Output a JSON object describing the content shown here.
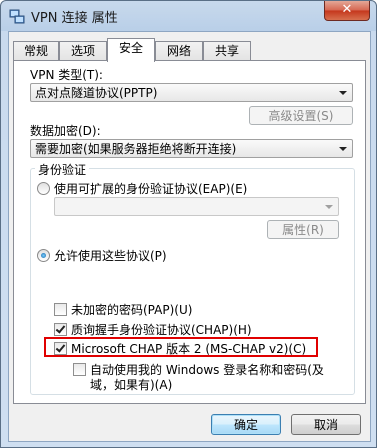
{
  "window": {
    "title": "VPN 连接 属性",
    "close_glyph": "✕"
  },
  "tabs": [
    {
      "label": "常规",
      "active": false
    },
    {
      "label": "选项",
      "active": false
    },
    {
      "label": "安全",
      "active": true
    },
    {
      "label": "网络",
      "active": false
    },
    {
      "label": "共享",
      "active": false
    }
  ],
  "vpn_type": {
    "label": "VPN 类型(T):",
    "value": "点对点隧道协议(PPTP)"
  },
  "advanced_button": "高级设置(S)",
  "encryption": {
    "label": "数据加密(D):",
    "value": "需要加密(如果服务器拒绝将断开连接)"
  },
  "auth_group": {
    "title": "身份验证",
    "eap_radio_label": "使用可扩展的身份验证协议(EAP)(E)",
    "eap_combo_value": "",
    "properties_button": "属性(R)",
    "allow_radio_label": "允许使用这些协议(P)"
  },
  "protocols": [
    {
      "label": "未加密的密码(PAP)(U)",
      "checked": false
    },
    {
      "label": "质询握手身份验证协议(CHAP)(H)",
      "checked": true
    },
    {
      "label": "Microsoft CHAP 版本 2 (MS-CHAP v2)(C)",
      "checked": true
    }
  ],
  "auto_logon": {
    "line1": "自动使用我的 Windows 登录名称和密码(及",
    "line2": "域，如果有)(A)",
    "checked": false
  },
  "footer": {
    "ok": "确定",
    "cancel": "取消"
  },
  "colors": {
    "highlight": "#e00000",
    "default_button": "#3c7fb1"
  }
}
